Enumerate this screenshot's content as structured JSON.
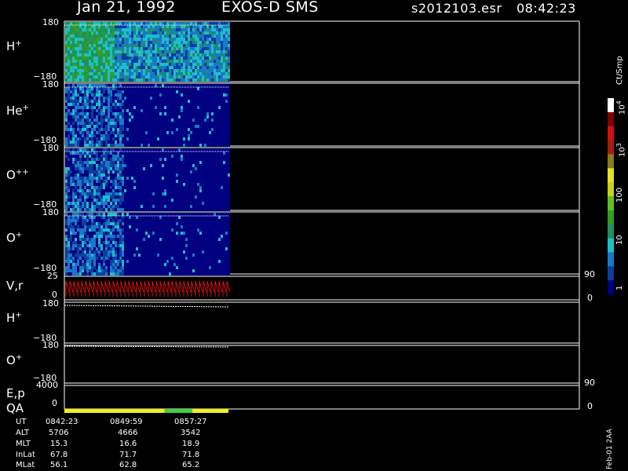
{
  "header": {
    "date": "Jan 21, 1992",
    "instrument": "EXOS-D SMS",
    "file": "s2012103.esr",
    "time": "08:42:23"
  },
  "panels": [
    {
      "species": "H",
      "charge": "+",
      "top_tick": "180",
      "bottom_tick": "−180"
    },
    {
      "species": "He",
      "charge": "+",
      "top_tick": "180",
      "bottom_tick": "−180"
    },
    {
      "species": "O",
      "charge": "++",
      "top_tick": "180",
      "bottom_tick": "−180"
    },
    {
      "species": "O",
      "charge": "+",
      "top_tick": "180",
      "bottom_tick": "−180"
    }
  ],
  "vr_panel": {
    "label": "V,r",
    "left_top": "25",
    "left_bottom": "0",
    "right_top": "90",
    "right_bottom": "0"
  },
  "line_panels": [
    {
      "species": "H",
      "charge": "+",
      "top_tick": "180",
      "bottom_tick": "−180"
    },
    {
      "species": "O",
      "charge": "+",
      "top_tick": "180",
      "bottom_tick": "−180"
    }
  ],
  "ep_panel": {
    "label": "E,p",
    "left_top": "4000",
    "left_bottom": "0",
    "right_top": "90",
    "right_bottom": "0"
  },
  "qa_label": "QA",
  "colorbar": {
    "unit": "Ct/Smp",
    "labels": [
      {
        "text": "10"
      },
      {
        "text": "10"
      },
      {
        "text": "100"
      },
      {
        "text": "10"
      },
      {
        "text": "1"
      }
    ],
    "exponents": [
      "4",
      "3"
    ]
  },
  "footer": {
    "rows": [
      {
        "name": "UT",
        "values": [
          "0842:23",
          "0849:59",
          "0857:27"
        ]
      },
      {
        "name": "ALT",
        "values": [
          "5706",
          "4666",
          "3542"
        ]
      },
      {
        "name": "MLT",
        "values": [
          "15.3",
          "16.6",
          "18.9"
        ]
      },
      {
        "name": "InLat",
        "values": [
          "67.8",
          "71.7",
          "71.8"
        ]
      },
      {
        "name": "MLat",
        "values": [
          "56.1",
          "62.8",
          "65.2"
        ]
      }
    ],
    "stamp": "Feb-01 2AA"
  },
  "chart_data": {
    "type": "heatmap",
    "title": "Jan 21, 1992   EXOS-D SMS",
    "x_ticks": [
      "0842:23",
      "0849:59",
      "0857:27"
    ],
    "y_range": [
      -180,
      180
    ],
    "series": [
      {
        "name": "H+",
        "ylim": [
          -180,
          180
        ],
        "mean_level": 2.3
      },
      {
        "name": "He+",
        "ylim": [
          -180,
          180
        ],
        "mean_level": 0.5
      },
      {
        "name": "O++",
        "ylim": [
          -180,
          180
        ],
        "mean_level": 0.6
      },
      {
        "name": "O+",
        "ylim": [
          -180,
          180
        ],
        "mean_level": 0.6
      }
    ],
    "colorscale": [
      "#000080",
      "#0a3fa0",
      "#1a78c8",
      "#1ebec8",
      "#209060",
      "#30a020",
      "#60c020",
      "#c8d020",
      "#e8e020",
      "#8a7a20",
      "#a02010",
      "#d01010",
      "#800000",
      "#ffffff"
    ],
    "colorbar_range": [
      1,
      10000
    ],
    "qa_segments": [
      {
        "from": 0,
        "to": 0.61,
        "color": "#f0f020"
      },
      {
        "from": 0.61,
        "to": 0.78,
        "color": "#40d040"
      },
      {
        "from": 0.78,
        "to": 1,
        "color": "#f0f020"
      }
    ]
  }
}
